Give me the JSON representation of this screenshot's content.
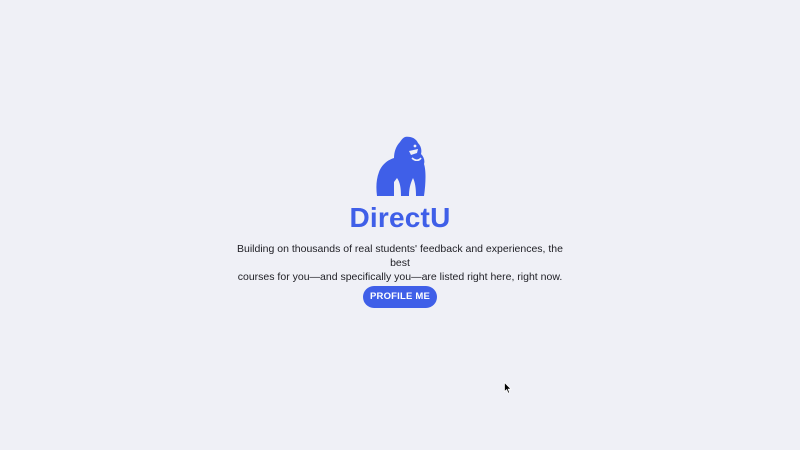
{
  "brand": {
    "name": "DirectU",
    "logo_icon": "gorilla-icon",
    "color": "#3f5fe8"
  },
  "hero": {
    "tagline_line1": "Building on thousands of real students' feedback and experiences, the best",
    "tagline_line2": "courses for you—and specifically you—are listed right here, right now."
  },
  "cta": {
    "label": "PROFILE ME",
    "color": "#3f5fe8"
  },
  "cursor_icon": "mouse-pointer-icon",
  "background": "#eff0f6"
}
